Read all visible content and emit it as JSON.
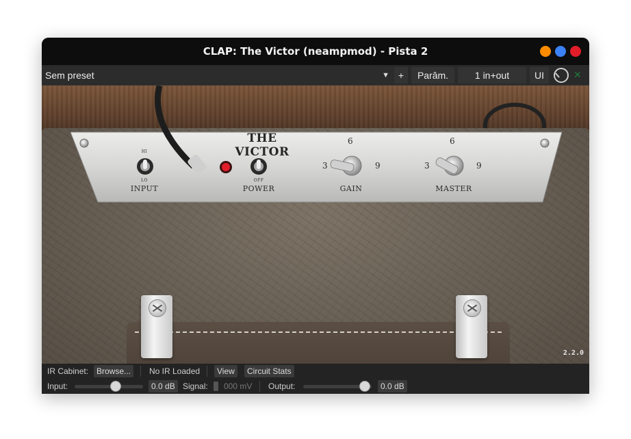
{
  "window": {
    "title": "CLAP: The Victor (neampmod) - Pista 2",
    "buttons": [
      {
        "name": "minimize",
        "color": "#ff8c00"
      },
      {
        "name": "maximize",
        "color": "#3b82f6"
      },
      {
        "name": "close",
        "color": "#e11d2a"
      }
    ]
  },
  "toolbar": {
    "preset": "Sem preset",
    "add": "+",
    "params": "Parâm.",
    "io": "1 in+out",
    "ui": "UI",
    "close_icon": "x"
  },
  "amp": {
    "brand": "THE VICTOR",
    "controls": {
      "input": {
        "label": "INPUT",
        "top_mark": "HI",
        "bottom_mark": "LO"
      },
      "power": {
        "label": "POWER",
        "bottom_mark": "OFF"
      },
      "gain": {
        "label": "GAIN",
        "scale": [
          "3",
          "6",
          "9"
        ]
      },
      "master": {
        "label": "MASTER",
        "scale": [
          "3",
          "6",
          "9"
        ]
      }
    },
    "version": "2.2.0",
    "colors": {
      "panel": "#d8d8d6",
      "led": "#e11d2a"
    }
  },
  "bottom": {
    "ir_label": "IR Cabinet:",
    "browse": "Browse...",
    "ir_status": "No IR Loaded",
    "view": "View",
    "circuit_stats": "Circuit Stats",
    "input_label": "Input:",
    "input_value": "0.0 dB",
    "input_level": 0.6,
    "signal_label": "Signal:",
    "signal_value": "000 mV",
    "output_label": "Output:",
    "output_value": "0.0 dB",
    "output_level": 0.9
  }
}
